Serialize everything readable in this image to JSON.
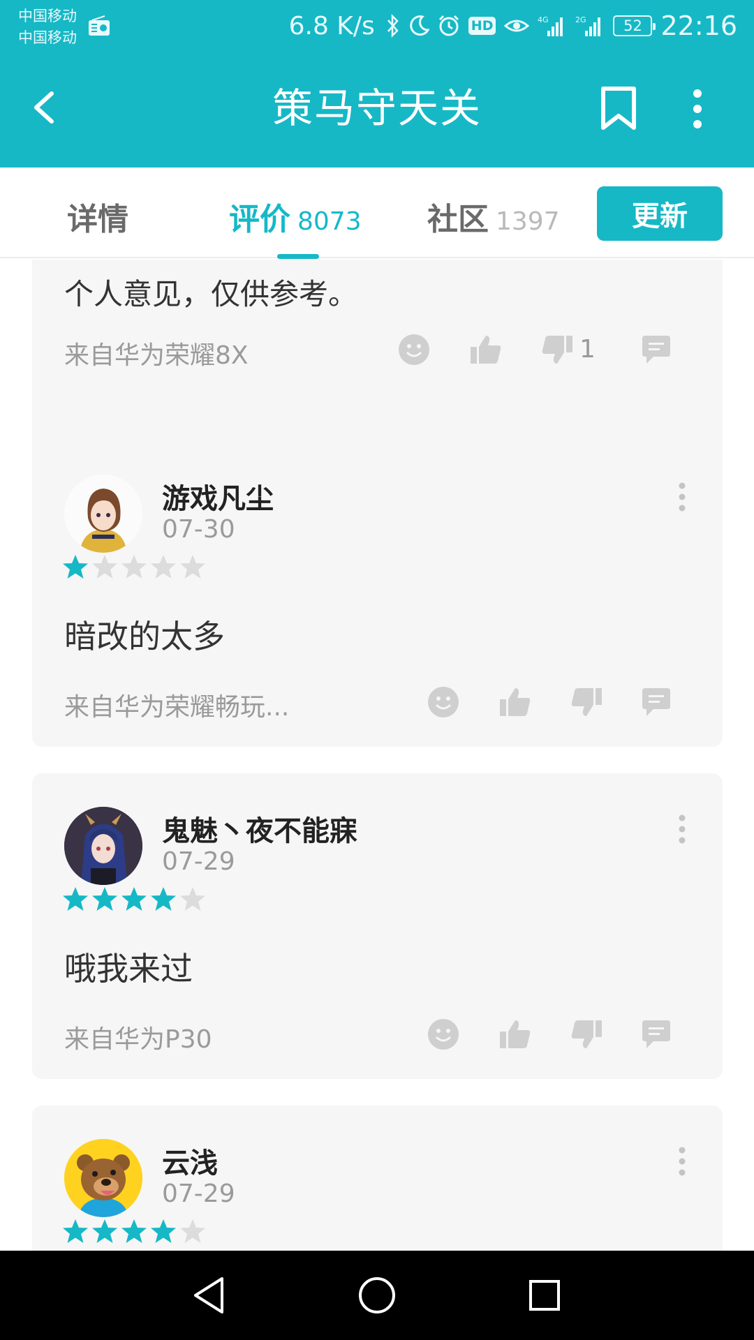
{
  "status_bar": {
    "carrier_1": "中国移动",
    "carrier_2": "中国移动",
    "net_speed": "6.8 K/s",
    "hd": "HD",
    "signal_1": "4G",
    "signal_2": "2G",
    "battery": "52",
    "time": "22:16"
  },
  "app_bar": {
    "title": "策马守天关",
    "back_icon": "chevron-left-icon",
    "bookmark_icon": "bookmark-icon",
    "more_icon": "more-vertical-icon"
  },
  "tabs": [
    {
      "label": "详情",
      "count": ""
    },
    {
      "label": "评价",
      "count": "8073",
      "active": true
    },
    {
      "label": "社区",
      "count": "1397"
    }
  ],
  "update_button": "更新",
  "colors": {
    "accent": "#16b8c6",
    "star_off": "#dcdcdc",
    "card_bg": "#f6f6f6"
  },
  "reviews": [
    {
      "partial": true,
      "text_line_2": "个人意见，仅供参考。",
      "device": "来自华为荣耀8X",
      "dislike_count": "1"
    },
    {
      "username": "游戏凡尘",
      "date": "07-30",
      "rating": 1,
      "text": "暗改的太多",
      "device": "来自华为荣耀畅玩..."
    },
    {
      "username": "鬼魅丶夜不能寐",
      "date": "07-29",
      "rating": 4,
      "text": "哦我来过",
      "device": "来自华为P30"
    },
    {
      "username": "云浅",
      "date": "07-29",
      "rating": 4
    }
  ],
  "nav": {
    "back": "triangle-back-icon",
    "home": "circle-home-icon",
    "recents": "square-recents-icon"
  }
}
